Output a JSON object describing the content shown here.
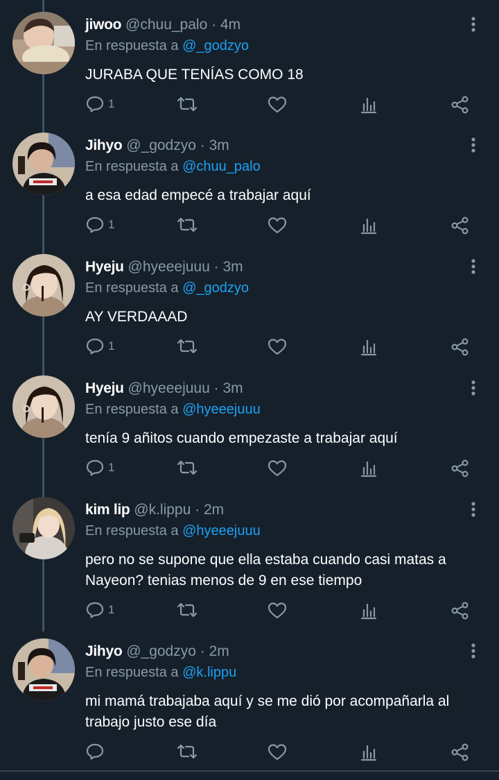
{
  "reply_prefix": "En respuesta a",
  "dot": "·",
  "tweets": [
    {
      "name": "jiwoo",
      "handle": "@chuu_palo",
      "time": "4m",
      "reply_to": "@_godzyo",
      "text": "JURABA QUE TENÍAS COMO 18",
      "reply_count": "1"
    },
    {
      "name": "Jihyo",
      "handle": "@_godzyo",
      "time": "3m",
      "reply_to": "@chuu_palo",
      "text": "a esa edad empecé a trabajar aquí",
      "reply_count": "1"
    },
    {
      "name": "Hyeju",
      "handle": "@hyeeejuuu",
      "time": "3m",
      "reply_to": "@_godzyo",
      "text": "AY VERDAAAD",
      "reply_count": "1"
    },
    {
      "name": "Hyeju",
      "handle": "@hyeeejuuu",
      "time": "3m",
      "reply_to": "@hyeeejuuu",
      "text": "tenía 9 añitos cuando empezaste a trabajar aquí",
      "reply_count": "1"
    },
    {
      "name": "kim lip",
      "handle": "@k.lippu",
      "time": "2m",
      "reply_to": "@hyeeejuuu",
      "text": "pero no se supone que ella estaba cuando casi matas a Nayeon? tenias menos de 9 en ese tiempo",
      "reply_count": "1"
    },
    {
      "name": "Jihyo",
      "handle": "@_godzyo",
      "time": "2m",
      "reply_to": "@k.lippu",
      "text": "mi mamá trabajaba aquí y se me dió por acompañarla al trabajo justo ese día",
      "reply_count": ""
    }
  ],
  "icons": {
    "reply": "reply-icon",
    "retweet": "retweet-icon",
    "like": "heart-icon",
    "analytics": "analytics-icon",
    "share": "share-icon",
    "more": "more-vertical-icon"
  },
  "colors": {
    "background": "#15202b",
    "text": "#ffffff",
    "secondary": "#8899a6",
    "link": "#1da1f2",
    "thread_line": "#3d5466"
  }
}
